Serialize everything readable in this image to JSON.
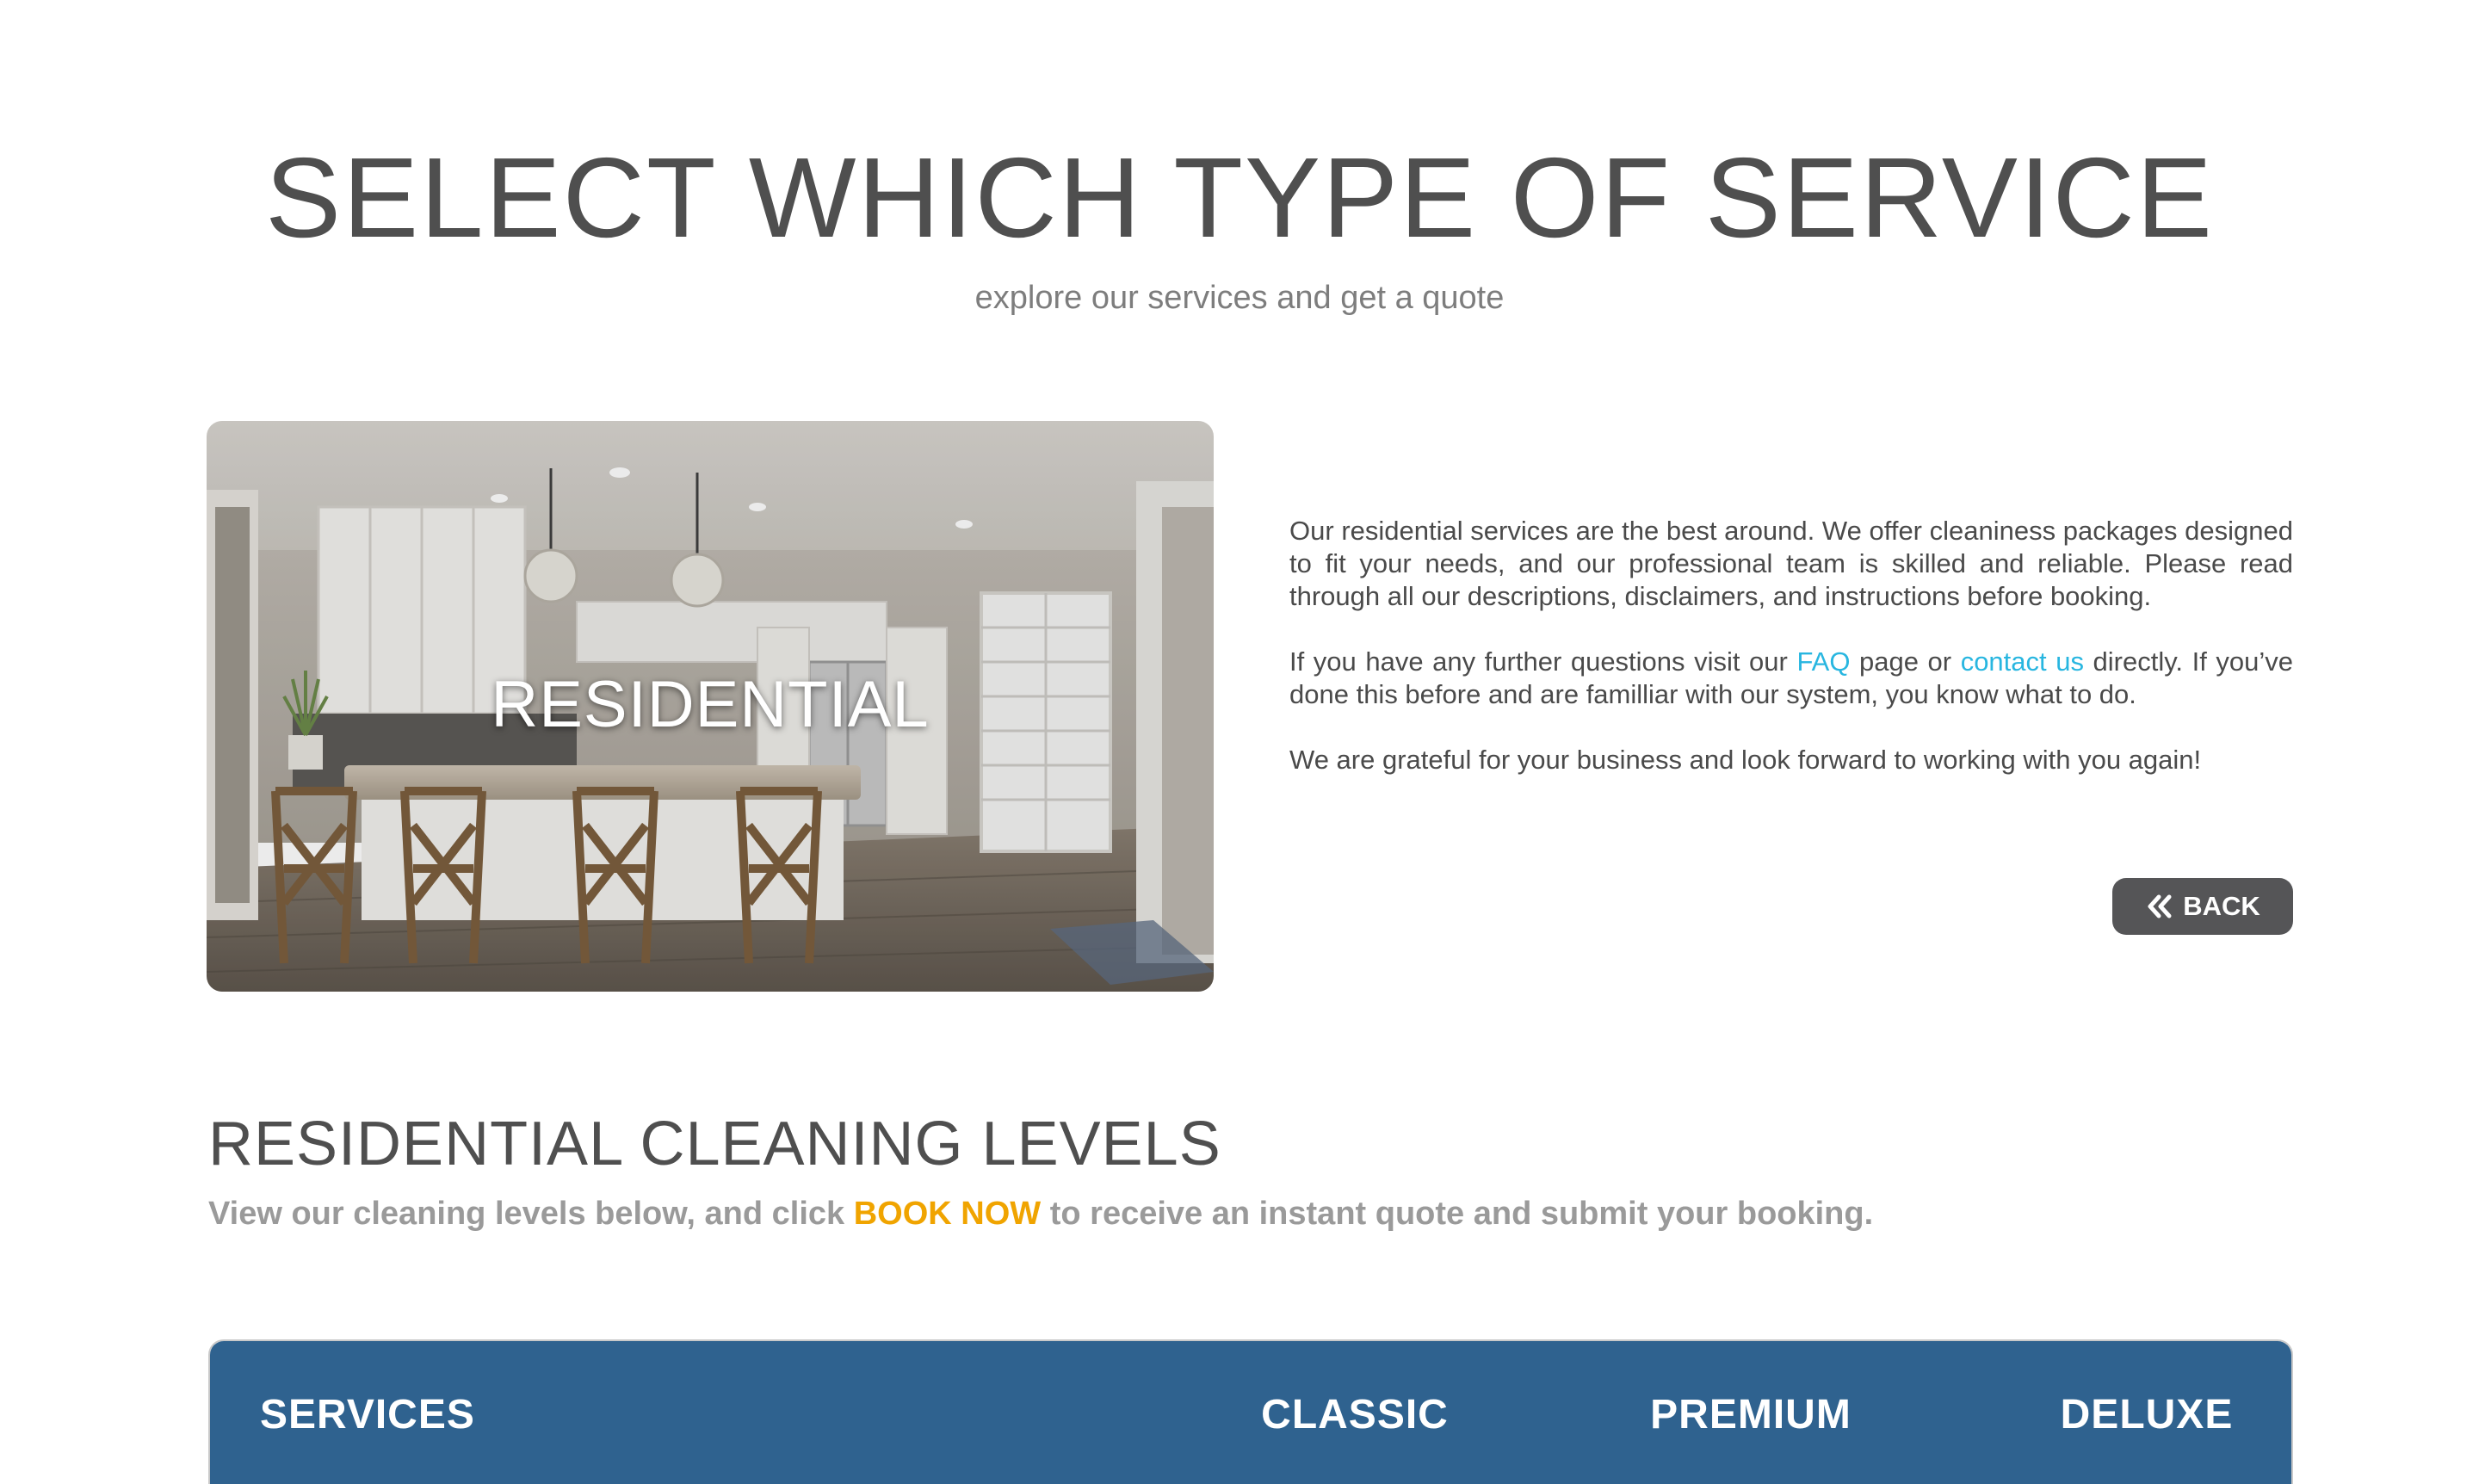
{
  "header": {
    "title": "SELECT WHICH TYPE OF SERVICE",
    "subtitle": "explore our services and get a quote"
  },
  "service_card": {
    "label": "RESIDENTIAL",
    "image": "kitchen-with-island-and-bar-stools"
  },
  "description": {
    "p1": "Our residential services are the best around. We offer cleaniness packages designed to fit your needs, and our  professional team is skilled and reliable. Please read through all our descriptions, disclaimers, and instructions before booking.",
    "p2_before": "If you have any further questions visit our ",
    "faq_link": "FAQ",
    "p2_middle": " page or ",
    "contact_link": "contact us",
    "p2_after": " directly. If you’ve done this before and are familliar with our system, you know what to do.",
    "p3": "We are grateful for your business and look forward to working with you again!",
    "link_color": "#28b6e0"
  },
  "back_button": {
    "label": "BACK",
    "icon": "double-chevron-left-icon",
    "color": "#555557"
  },
  "levels": {
    "title": "RESIDENTIAL CLEANING LEVELS",
    "sub_before": "View our cleaning levels below, and click ",
    "book_now": "BOOK NOW",
    "sub_after": " to receive an instant quote and submit your booking.",
    "accent": "#f0a400"
  },
  "table": {
    "header_color": "#2f628f",
    "columns": [
      "SERVICES",
      "CLASSIC",
      "PREMIUM",
      "DELUXE"
    ]
  }
}
